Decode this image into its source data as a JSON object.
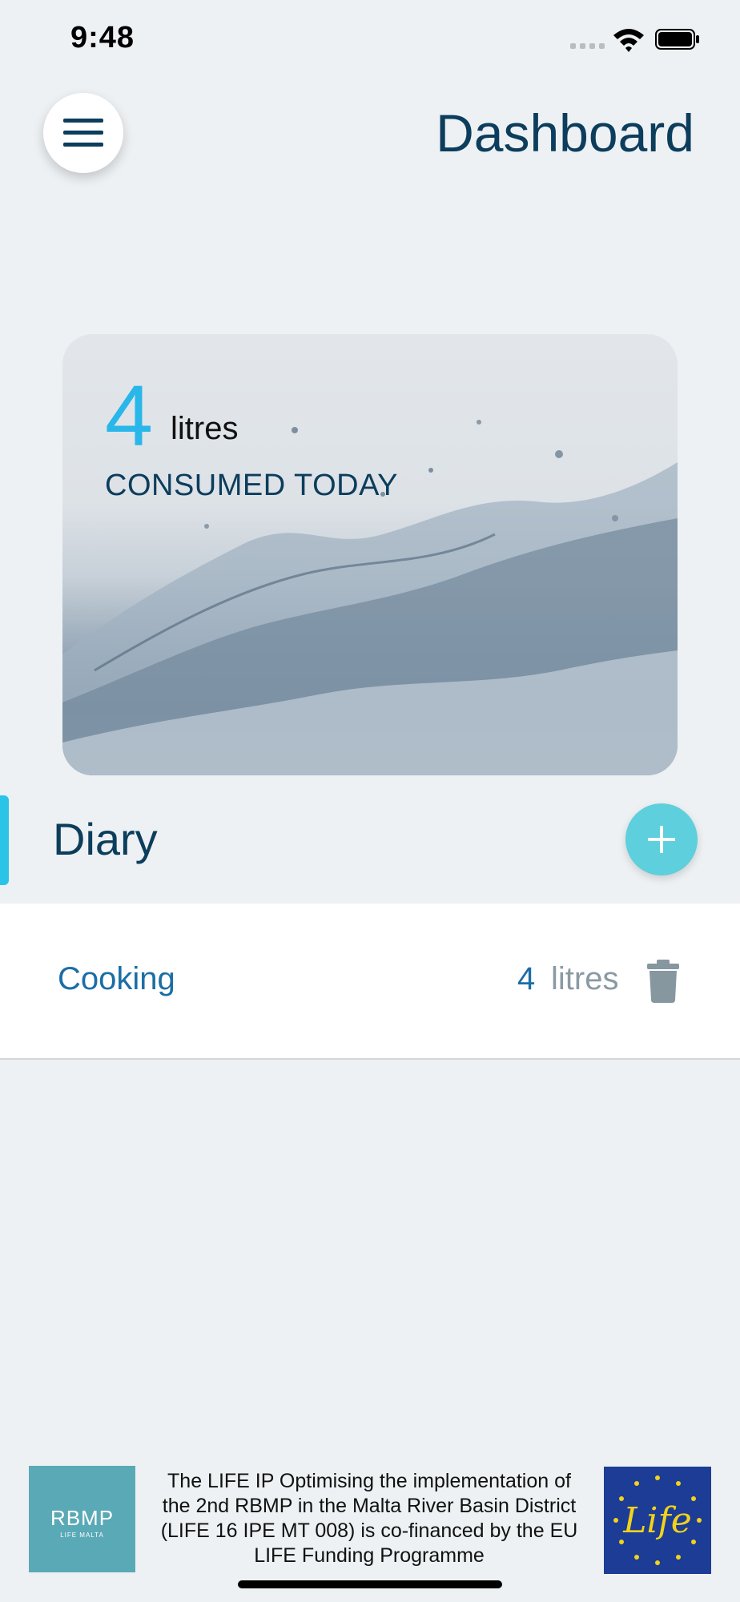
{
  "status_bar": {
    "time": "9:48"
  },
  "header": {
    "title": "Dashboard",
    "menu_icon": "hamburger-menu-icon"
  },
  "consumption": {
    "value": "4",
    "unit": "litres",
    "label": "CONSUMED TODAY"
  },
  "diary": {
    "title": "Diary",
    "add_icon": "plus-icon",
    "entries": [
      {
        "name": "Cooking",
        "amount": "4",
        "unit": "litres",
        "delete_icon": "trash-icon"
      }
    ]
  },
  "footer": {
    "left_logo": "RBMP",
    "left_logo_sub": "LIFE MALTA",
    "text": "The LIFE IP Optimising the implementation of the 2nd RBMP in the Malta River Basin District (LIFE 16 IPE MT 008) is co-financed by the EU LIFE Funding Programme",
    "right_logo": "Life"
  },
  "colors": {
    "accent": "#29b6e8",
    "navy": "#0c3d5c",
    "add_button": "#5ecfdc",
    "background": "#edf1f3"
  }
}
